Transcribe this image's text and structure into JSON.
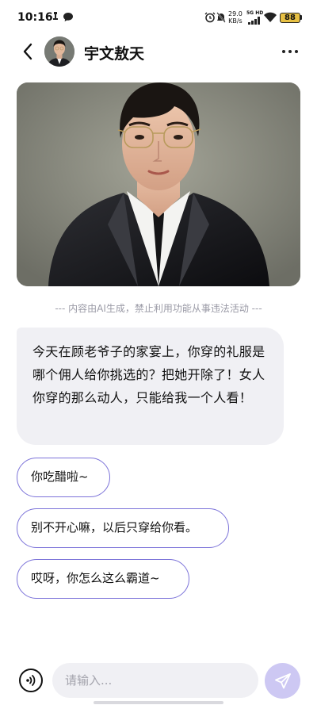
{
  "status_bar": {
    "time": "10:16",
    "network_speed": "29.0",
    "network_speed_unit": "KB/s",
    "network_type": "5G HD",
    "battery": "88",
    "colors": {
      "battery_fill": "#e7c043"
    }
  },
  "header": {
    "title": "宇文敖天",
    "back_icon": "chevron-left-icon",
    "more_icon": "more-horizontal-icon"
  },
  "disclaimer": "--- 内容由AI生成，禁止利用功能从事违法活动 ---",
  "chat": {
    "ai_message": "今天在顾老爷子的家宴上，你穿的礼服是哪个佣人给你挑选的？把她开除了！女人你穿的那么动人，只能给我一个人看！"
  },
  "reply_options": [
    {
      "label": "你吃醋啦~"
    },
    {
      "label": "别不开心嘛，以后只穿给你看。"
    },
    {
      "label": "哎呀，你怎么这么霸道~"
    }
  ],
  "input": {
    "placeholder": "请输入...",
    "value": "",
    "voice_icon": "voice-wave-icon",
    "send_icon": "send-icon"
  },
  "colors": {
    "accent": "#7c73d9",
    "send_button": "#cdc8f3",
    "bubble_bg": "#f0f0f4"
  }
}
